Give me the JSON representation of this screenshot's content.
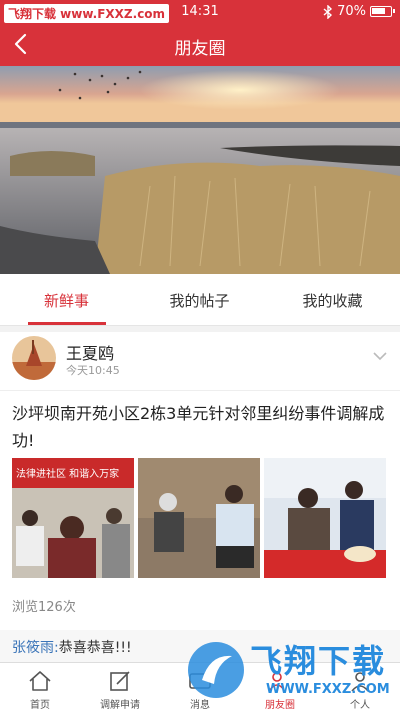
{
  "status_bar": {
    "watermark_text": "飞翔下载 www.FXXZ.com",
    "time": "14:31",
    "battery": "70%",
    "icons": [
      "bluetooth-icon",
      "battery-icon"
    ]
  },
  "nav": {
    "title": "朋友圈",
    "back_icon": "chevron-left-icon"
  },
  "tabs": [
    {
      "label": "新鲜事",
      "active": true
    },
    {
      "label": "我的帖子",
      "active": false
    },
    {
      "label": "我的收藏",
      "active": false
    }
  ],
  "post": {
    "user_name": "王夏鸥",
    "time": "今天10:45",
    "text": "沙坪坝南开苑小区2栋3单元针对邻里纠纷事件调解成功!",
    "photo_banner_text": "法律进社区 和谐入万家",
    "views": "浏览126次"
  },
  "comment": {
    "author": "张筱雨:",
    "text": "恭喜恭喜!!!"
  },
  "tabbar": [
    {
      "label": "首页",
      "icon": "home-icon"
    },
    {
      "label": "调解申请",
      "icon": "edit-icon"
    },
    {
      "label": "消息",
      "icon": "message-icon"
    },
    {
      "label": "朋友圈",
      "icon": "friends-icon",
      "active": true
    },
    {
      "label": "个人",
      "icon": "person-icon"
    }
  ],
  "watermark": {
    "brand": "飞翔下载",
    "url": "WWW.FXXZ.COM"
  },
  "colors": {
    "accent": "#d8323a",
    "link": "#3a74b8",
    "watermark": "#2a8dde"
  }
}
